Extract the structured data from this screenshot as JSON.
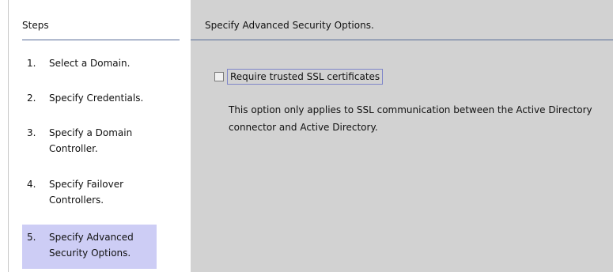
{
  "steps": {
    "header": "Steps",
    "items": [
      {
        "num": "1.",
        "label": "Select a Domain."
      },
      {
        "num": "2.",
        "label": "Specify Credentials."
      },
      {
        "num": "3.",
        "label": "Specify a Domain Controller."
      },
      {
        "num": "4.",
        "label": "Specify Failover Controllers."
      },
      {
        "num": "5.",
        "label": "Specify Advanced Security Options."
      }
    ],
    "active_index": 4
  },
  "content": {
    "title": "Specify Advanced Security Options.",
    "checkbox_label": "Require trusted SSL certificates",
    "checkbox_checked": false,
    "help_text": "This option only applies to SSL communication between the Active Directory connector and Active Directory."
  },
  "colors": {
    "content_bg": "#d2d2d2",
    "active_step_bg": "#cdcdf5",
    "rule": "#556a96"
  }
}
